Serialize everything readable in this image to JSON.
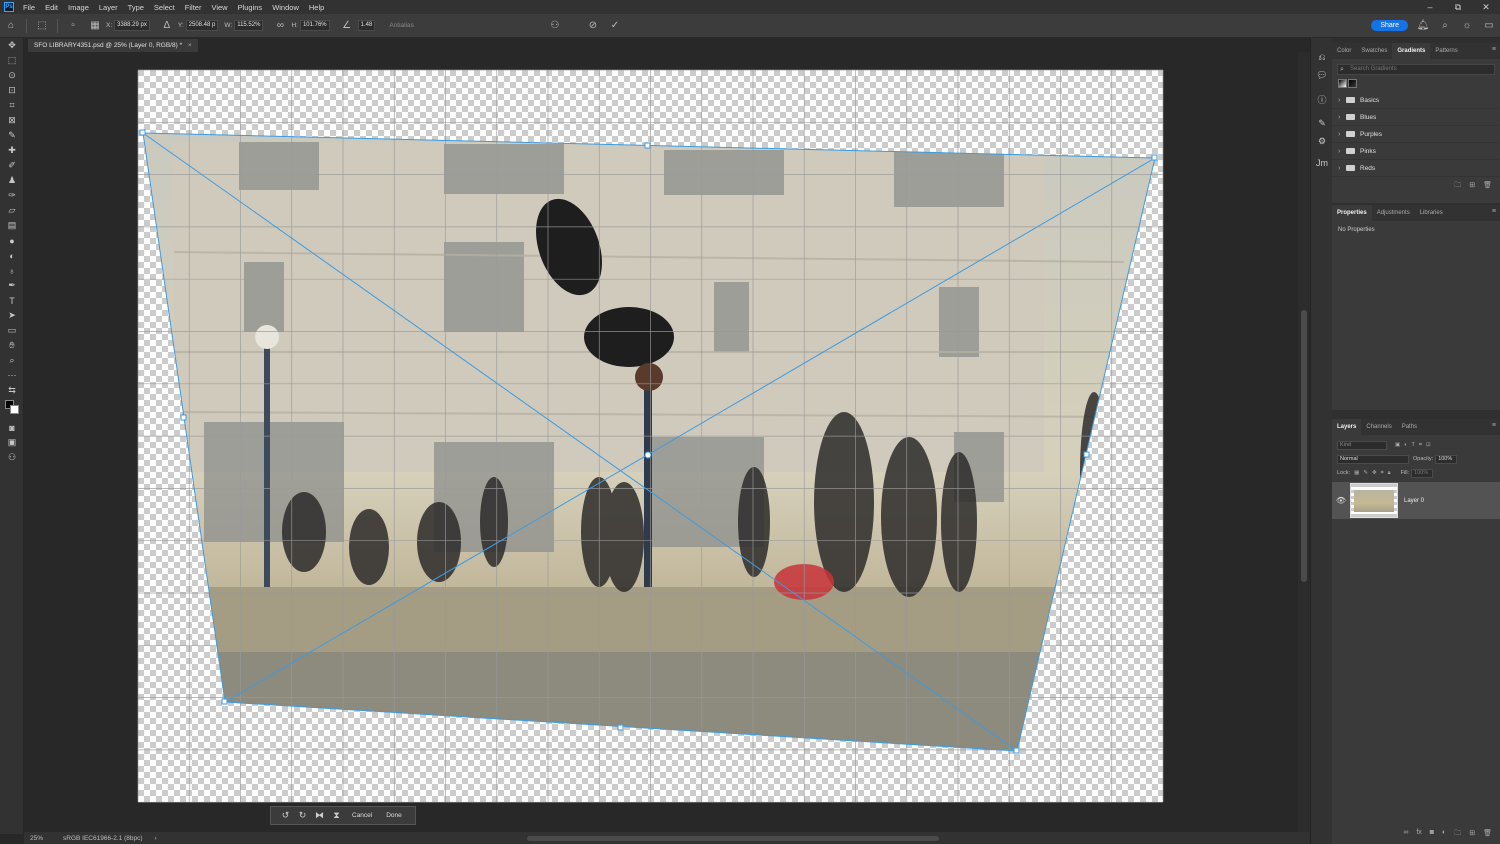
{
  "app": {
    "logo": "Ps"
  },
  "menu": [
    "File",
    "Edit",
    "Image",
    "Layer",
    "Type",
    "Select",
    "Filter",
    "View",
    "Plugins",
    "Window",
    "Help"
  ],
  "window_controls": [
    "–",
    "⧉",
    "✕"
  ],
  "options_bar": {
    "x_label": "X:",
    "x_value": "3388.29 px",
    "y_label": "Y:",
    "y_value": "2508.48 p",
    "w_label": "W:",
    "w_value": "115.52%",
    "h_label": "H:",
    "h_value": "101.76%",
    "angle_value": "1.48",
    "interpolation": "Antialias",
    "share_label": "Share"
  },
  "document_tab": {
    "title": "SFO LIBRARY4351.psd @ 25% (Layer 0, RGB/8) *",
    "close": "×"
  },
  "statusbar": {
    "zoom": "25%",
    "profile": "sRGB IEC61966-2.1 (8bpc)",
    "arrow": "›"
  },
  "transform_bar": {
    "cancel_label": "Cancel",
    "done_label": "Done"
  },
  "gradients_panel": {
    "tabs": [
      "Color",
      "Swatches",
      "Gradients",
      "Patterns"
    ],
    "active_tab": "Gradients",
    "search_placeholder": "Search Gradients",
    "folders": [
      "Basics",
      "Blues",
      "Purples",
      "Pinks",
      "Reds"
    ]
  },
  "properties_panel": {
    "tabs": [
      "Properties",
      "Adjustments",
      "Libraries"
    ],
    "active_tab": "Properties",
    "content": "No Properties"
  },
  "layers_panel": {
    "tabs": [
      "Layers",
      "Channels",
      "Paths"
    ],
    "active_tab": "Layers",
    "kind_placeholder": "Kind",
    "blend_mode": "Normal",
    "opacity_label": "Opacity:",
    "opacity_value": "100%",
    "lock_label": "Lock:",
    "fill_label": "Fill:",
    "fill_value": "100%",
    "layers": [
      {
        "name": "Layer 0",
        "visible": true
      }
    ]
  },
  "colors": {
    "accent": "#1473e6",
    "transform_line": "#3d9be0"
  }
}
